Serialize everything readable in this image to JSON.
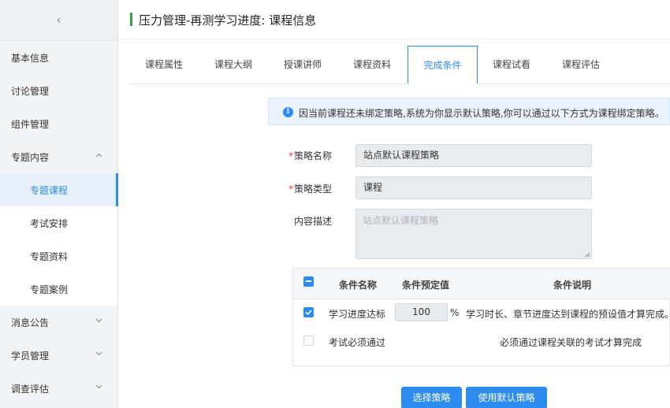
{
  "sidebar": {
    "collapse_glyph": "‹",
    "items": [
      {
        "label": "基本信息"
      },
      {
        "label": "讨论管理"
      },
      {
        "label": "组件管理"
      },
      {
        "label": "专题内容",
        "expanded": true
      },
      {
        "label": "专题课程",
        "active": true
      },
      {
        "label": "考试安排"
      },
      {
        "label": "专题资料"
      },
      {
        "label": "专题案例"
      },
      {
        "label": "消息公告"
      },
      {
        "label": "学员管理"
      },
      {
        "label": "调查评估"
      }
    ]
  },
  "header": {
    "title": "压力管理-再测学习进度: 课程信息"
  },
  "tabs": [
    {
      "label": "课程属性"
    },
    {
      "label": "课程大纲"
    },
    {
      "label": "授课讲师"
    },
    {
      "label": "课程资料"
    },
    {
      "label": "完成条件",
      "active": true
    },
    {
      "label": "课程试看"
    },
    {
      "label": "课程评估"
    }
  ],
  "notice": {
    "icon": "info-icon",
    "text": "因当前课程还未绑定策略,系统为你显示默认策略,你可以通过以下方式为课程绑定策略。"
  },
  "form": {
    "required_mark": "*",
    "strategy_name_label": "策略名称",
    "strategy_name_value": "站点默认课程策略",
    "strategy_type_label": "策略类型",
    "strategy_type_value": "课程",
    "description_label": "内容描述",
    "description_placeholder": "站点默认课程策略"
  },
  "conditions": {
    "headers": {
      "name": "条件名称",
      "preset": "条件预定值",
      "desc": "条件说明"
    },
    "rows": [
      {
        "checked": true,
        "name": "学习进度达标",
        "preset_value": "100",
        "unit": "%",
        "desc": "学习时长、章节进度达到课程的预设值才算完成。"
      },
      {
        "checked": false,
        "name": "考试必须通过",
        "desc": "必须通过课程关联的考试才算完成"
      }
    ]
  },
  "buttons": {
    "select_strategy": "选择策略",
    "use_default": "使用默认策略"
  },
  "colors": {
    "accent": "#2d8cf0",
    "header_bar": "#3aa04a",
    "required": "#e53935"
  }
}
